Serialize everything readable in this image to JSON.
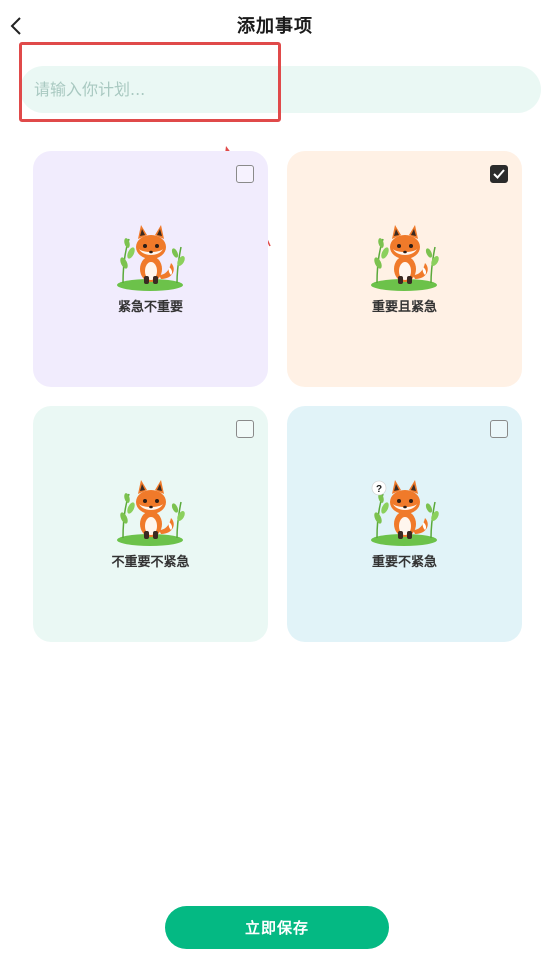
{
  "header": {
    "title": "添加事项"
  },
  "input": {
    "placeholder": "请输入你计划...",
    "value": ""
  },
  "cards": [
    {
      "label": "紧急不重要",
      "checked": false,
      "bg": "#f1ecfd"
    },
    {
      "label": "重要且紧急",
      "checked": true,
      "bg": "#fff1e5"
    },
    {
      "label": "不重要不紧急",
      "checked": false,
      "bg": "#eaf8f4"
    },
    {
      "label": "重要不紧急",
      "checked": false,
      "bg": "#e1f3f8"
    }
  ],
  "fox_marks": [
    "",
    "",
    "",
    "?"
  ],
  "save_label": "立即保存",
  "colors": {
    "accent": "#04b983",
    "highlight": "#e04a4a"
  }
}
